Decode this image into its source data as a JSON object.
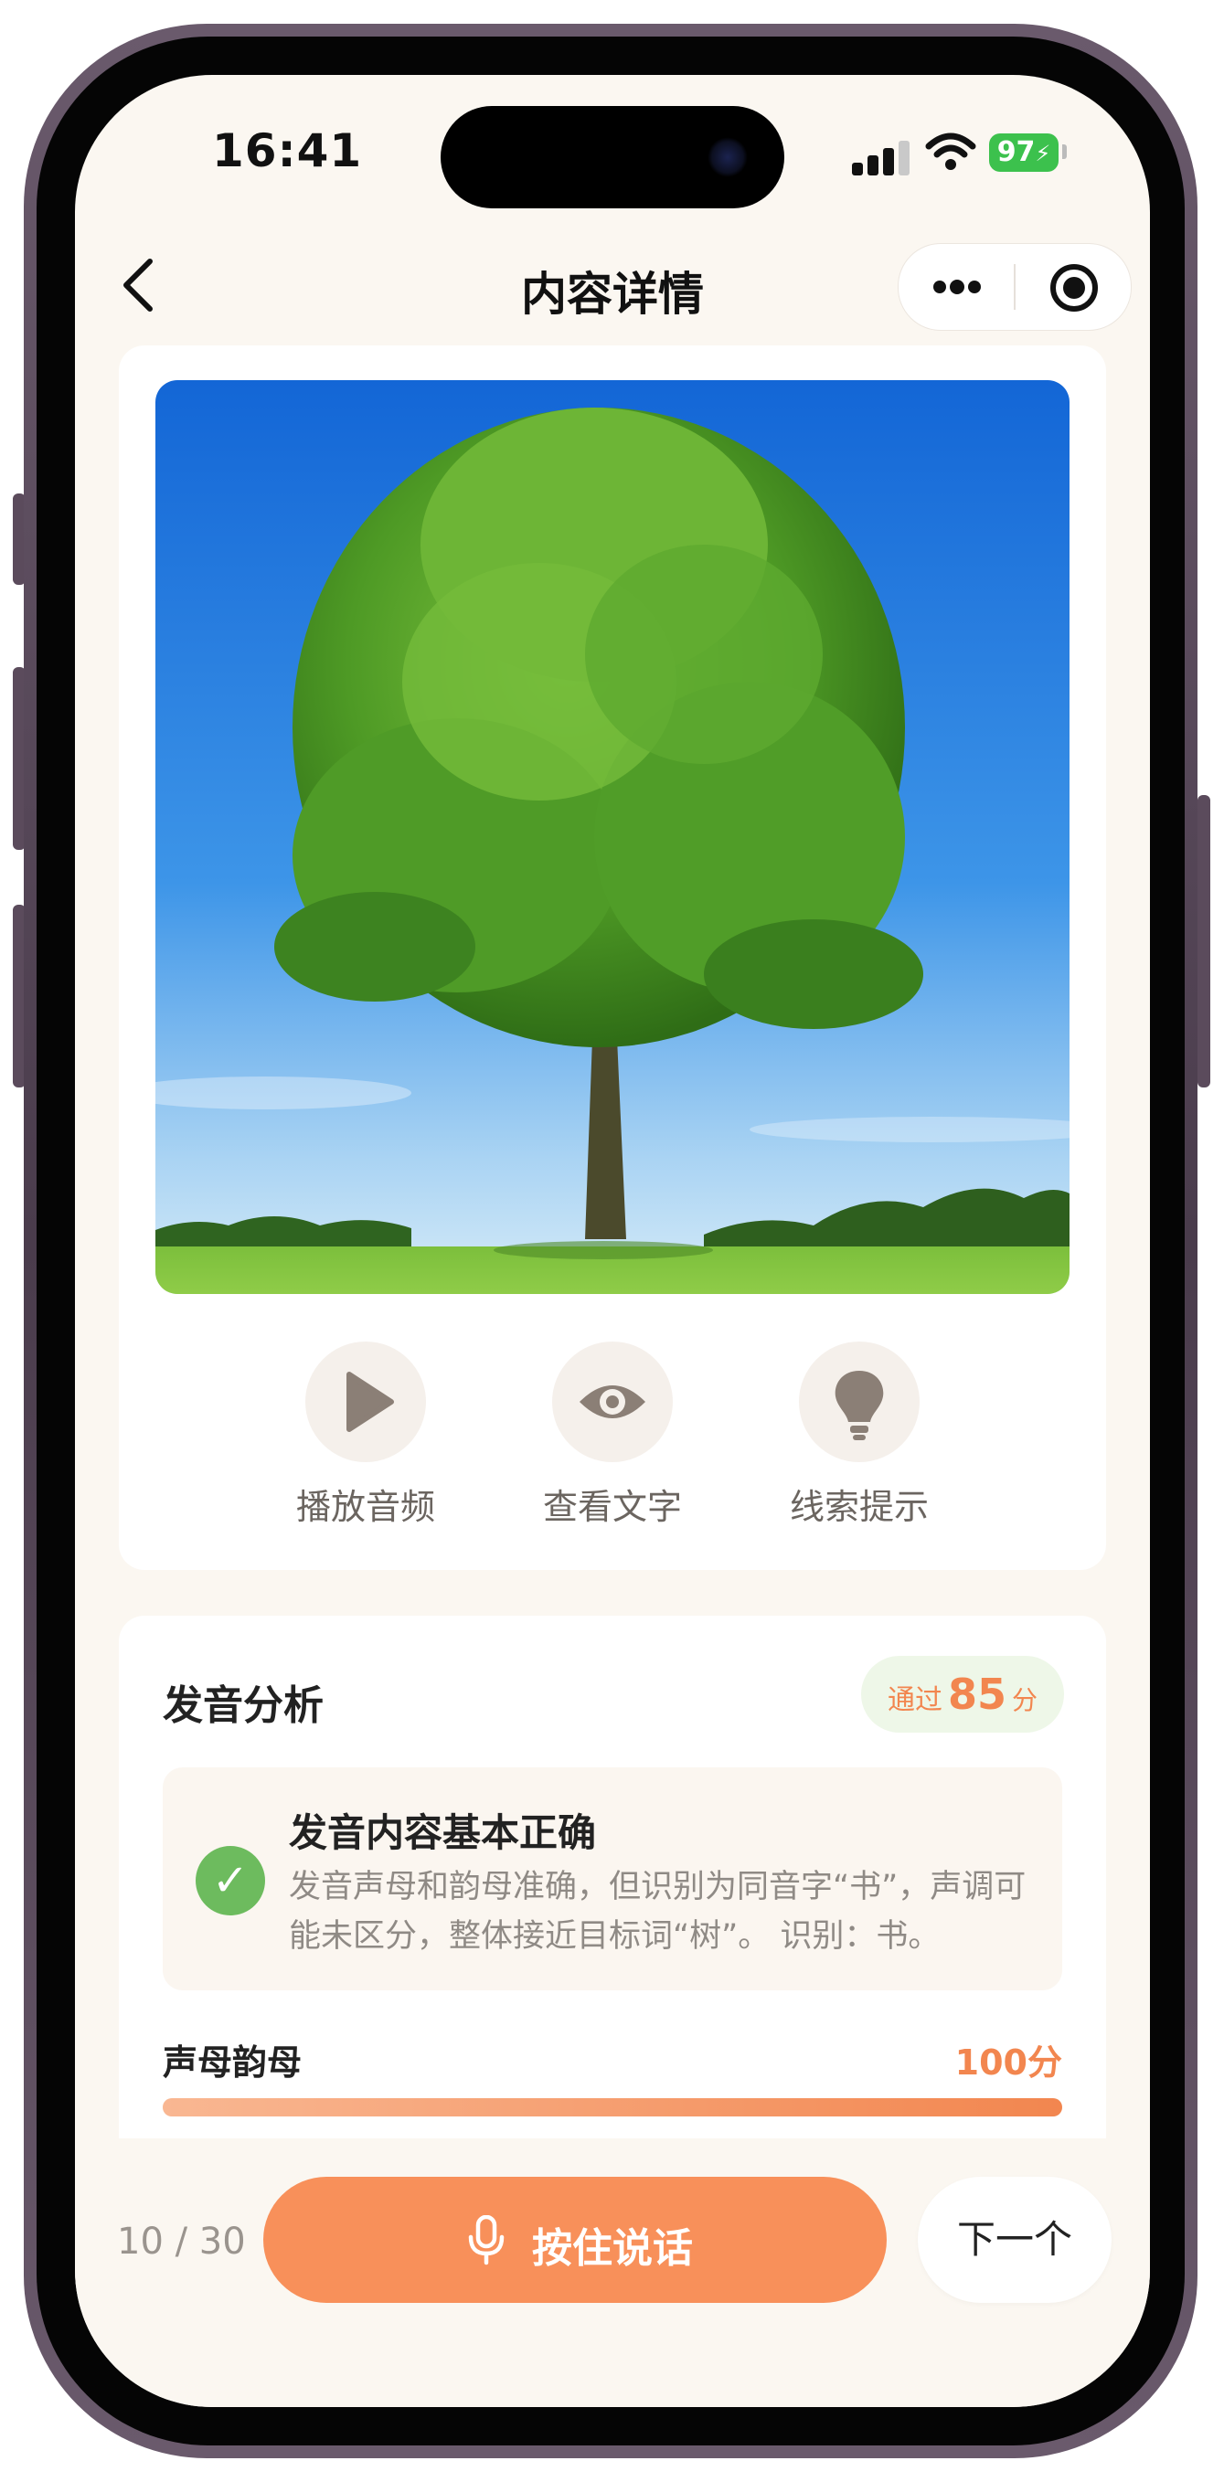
{
  "status": {
    "time": "16:41",
    "battery": "97"
  },
  "nav": {
    "title": "内容详情"
  },
  "actions": [
    {
      "label": "播放音频",
      "icon": "play-icon"
    },
    {
      "label": "查看文字",
      "icon": "eye-icon"
    },
    {
      "label": "线索提示",
      "icon": "lightbulb-icon"
    }
  ],
  "analysis": {
    "title": "发音分析",
    "badge_label": "通过",
    "badge_score": "85",
    "badge_unit": "分",
    "result_title": "发音内容基本正确",
    "result_desc": "发音声母和韵母准确，但识别为同音字“书”，声调可能未区分，整体接近目标词“树”。 识别：书。",
    "metric_name": "声母韵母",
    "metric_score": "100分",
    "metric_fraction": 1.0
  },
  "bottom": {
    "counter": "10 / 30",
    "speak_label": "按住说话",
    "next_label": "下一个"
  },
  "colors": {
    "accent": "#f8905a",
    "success": "#6dbb5e",
    "background": "#fbf7f1"
  }
}
